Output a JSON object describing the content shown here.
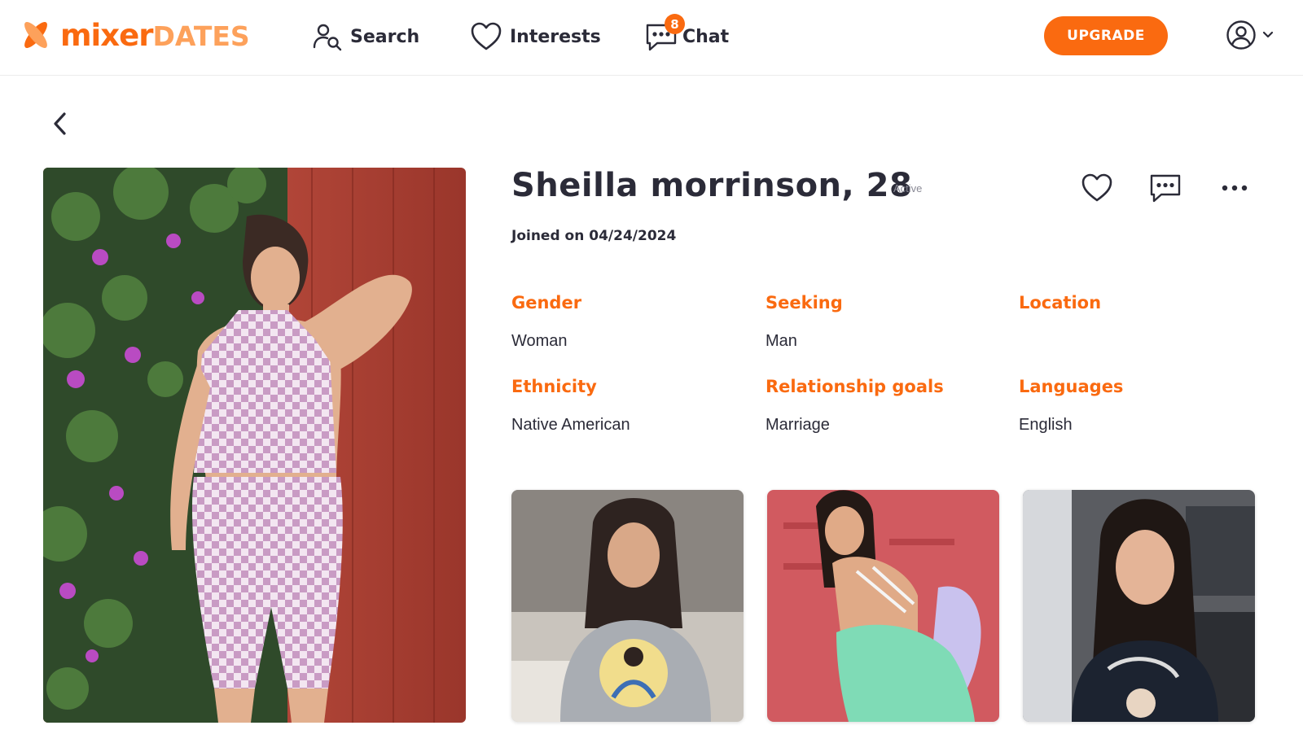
{
  "brand": {
    "name_part1": "mixer",
    "name_part2": "DATES",
    "accent_color": "#fa6a10",
    "accent_light": "#fda15b"
  },
  "nav": {
    "search_label": "Search",
    "interests_label": "Interests",
    "chat_label": "Chat",
    "chat_unread_count": "8"
  },
  "header": {
    "upgrade_label": "UPGRADE"
  },
  "profile": {
    "name_age": "Sheilla morrinson, 28",
    "status": "Active",
    "joined": "Joined on 04/24/2024",
    "details": [
      {
        "label": "Gender",
        "value": "Woman"
      },
      {
        "label": "Seeking",
        "value": "Man"
      },
      {
        "label": "Location",
        "value": ""
      },
      {
        "label": "Ethnicity",
        "value": "Native American"
      },
      {
        "label": "Relationship goals",
        "value": "Marriage"
      },
      {
        "label": "Languages",
        "value": "English"
      }
    ]
  },
  "icons": {
    "logo": "x-logo-icon",
    "search": "person-search-icon",
    "interests": "heart-icon",
    "chat": "chat-bubble-icon",
    "account": "user-circle-icon",
    "back": "chevron-left-icon",
    "like": "heart-icon",
    "message": "chat-bubble-icon",
    "more": "more-horizontal-icon"
  }
}
